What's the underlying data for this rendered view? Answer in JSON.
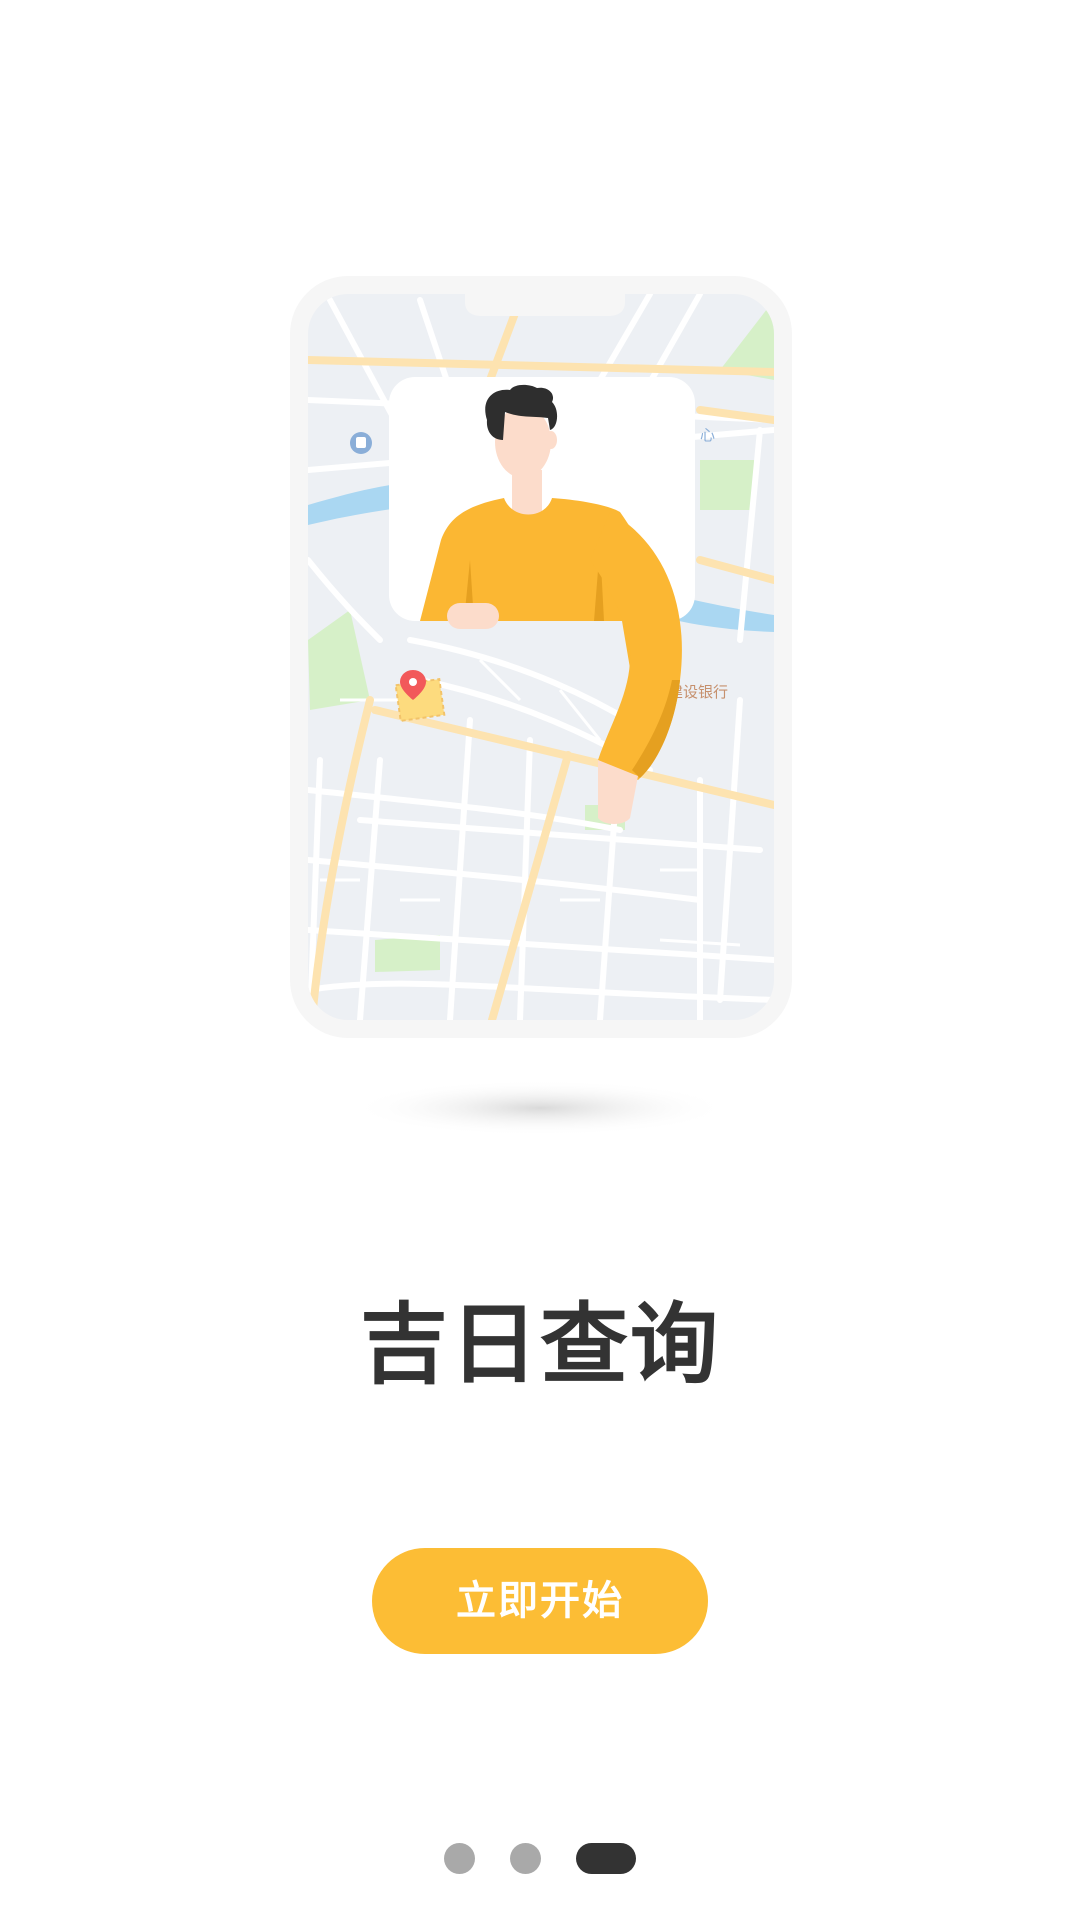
{
  "onboarding": {
    "title": "吉日查询",
    "start_button_label": "立即开始",
    "page_indicator": {
      "total": 3,
      "current": 3
    },
    "map_labels": {
      "bank": "建设银行",
      "center_fragment": "心"
    },
    "colors": {
      "accent": "#fcbd35",
      "title": "#333333",
      "dot_inactive": "#a9a9a9",
      "dot_active": "#333333"
    },
    "icons": {
      "location_pin": "map-pin-icon",
      "bus_stop": "bus-stop-icon"
    }
  }
}
